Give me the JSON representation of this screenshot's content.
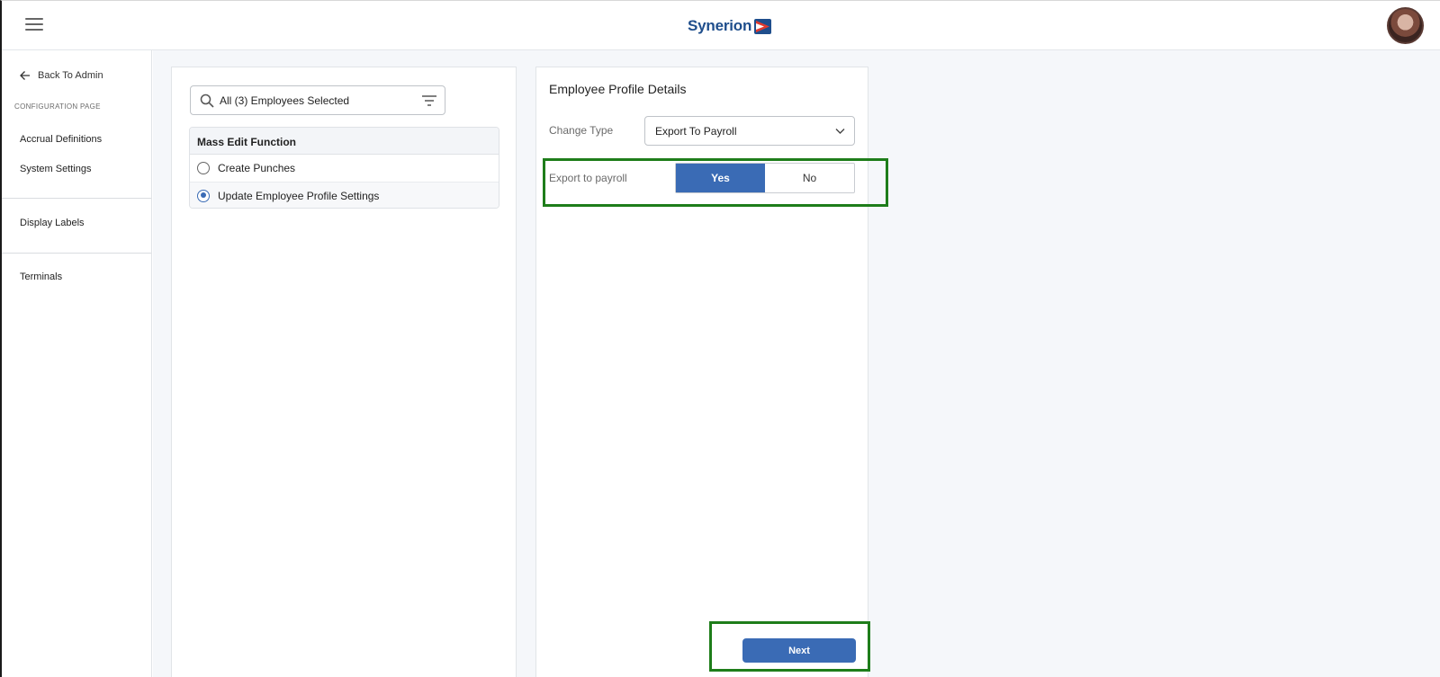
{
  "header": {
    "logo_text": "Synerion",
    "menu_icon": "hamburger-menu-icon",
    "avatar": "user-avatar"
  },
  "sidebar": {
    "back_label": "Back To Admin",
    "section_label": "CONFIGURATION PAGE",
    "items": [
      {
        "label": "Accrual Definitions"
      },
      {
        "label": "System Settings"
      },
      {
        "label": "Display Labels"
      },
      {
        "label": "Terminals"
      }
    ]
  },
  "employee_panel": {
    "search_value": "All (3) Employees Selected",
    "table_header": "Mass Edit Function",
    "options": [
      {
        "label": "Create Punches",
        "selected": false
      },
      {
        "label": "Update Employee Profile Settings",
        "selected": true
      }
    ]
  },
  "details_panel": {
    "title": "Employee Profile Details",
    "change_type_label": "Change Type",
    "change_type_value": "Export To Payroll",
    "export_label": "Export to payroll",
    "toggle_yes": "Yes",
    "toggle_no": "No",
    "toggle_value": "Yes",
    "next_label": "Next"
  },
  "colors": {
    "accent": "#3a6bb5",
    "brand": "#1f4e8c",
    "highlight": "#1e7d1a"
  }
}
